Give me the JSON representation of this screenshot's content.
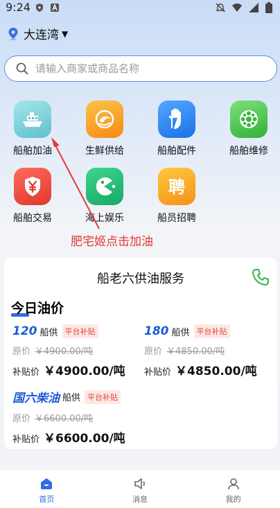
{
  "status_bar": {
    "time": "9:24"
  },
  "location": {
    "city": "大连湾",
    "caret": "▼"
  },
  "search": {
    "placeholder": "请输入商家或商品名称"
  },
  "grid": [
    {
      "label": "船舶加油",
      "icon": "ship-icon",
      "color": "#7fd3d8"
    },
    {
      "label": "生鲜供给",
      "icon": "shrimp-icon",
      "color": "#f7a325"
    },
    {
      "label": "船舶配件",
      "icon": "hand-icon",
      "color": "#2f86f6"
    },
    {
      "label": "船舶维修",
      "icon": "wheel-icon",
      "color": "#4fc24c"
    },
    {
      "label": "船舶交易",
      "icon": "yen-shield-icon",
      "color": "#ee4b3f"
    },
    {
      "label": "海上娱乐",
      "icon": "pacman-icon",
      "color": "#2fc07a"
    },
    {
      "label": "船员招聘",
      "icon": "recruit-icon",
      "color": "#f8ab1e"
    }
  ],
  "annotation": {
    "text": "肥宅姬点击加油"
  },
  "card": {
    "title": "船老六供油服务",
    "section_title": "今日油价",
    "prices": [
      {
        "fuel": "120",
        "supply": "船供",
        "badge": "平台补贴",
        "orig_label": "原价",
        "orig_price": "￥4900.00/吨",
        "sub_label": "补贴价",
        "sub_price": "￥4900.00/吨"
      },
      {
        "fuel": "180",
        "supply": "船供",
        "badge": "平台补贴",
        "orig_label": "原价",
        "orig_price": "￥4850.00/吨",
        "sub_label": "补贴价",
        "sub_price": "￥4850.00/吨"
      },
      {
        "fuel": "国六柴油",
        "supply": "船供",
        "badge": "平台补贴",
        "orig_label": "原价",
        "orig_price": "￥6600.00/吨",
        "sub_label": "补贴价",
        "sub_price": "￥6600.00/吨"
      }
    ]
  },
  "nav": [
    {
      "label": "首页",
      "icon": "home-icon",
      "active": true
    },
    {
      "label": "消息",
      "icon": "speaker-icon",
      "active": false
    },
    {
      "label": "我的",
      "icon": "profile-icon",
      "active": false
    }
  ],
  "colors": {
    "accent": "#2f6de0",
    "annotation": "#e53935",
    "badge_text": "#e24a3b"
  }
}
